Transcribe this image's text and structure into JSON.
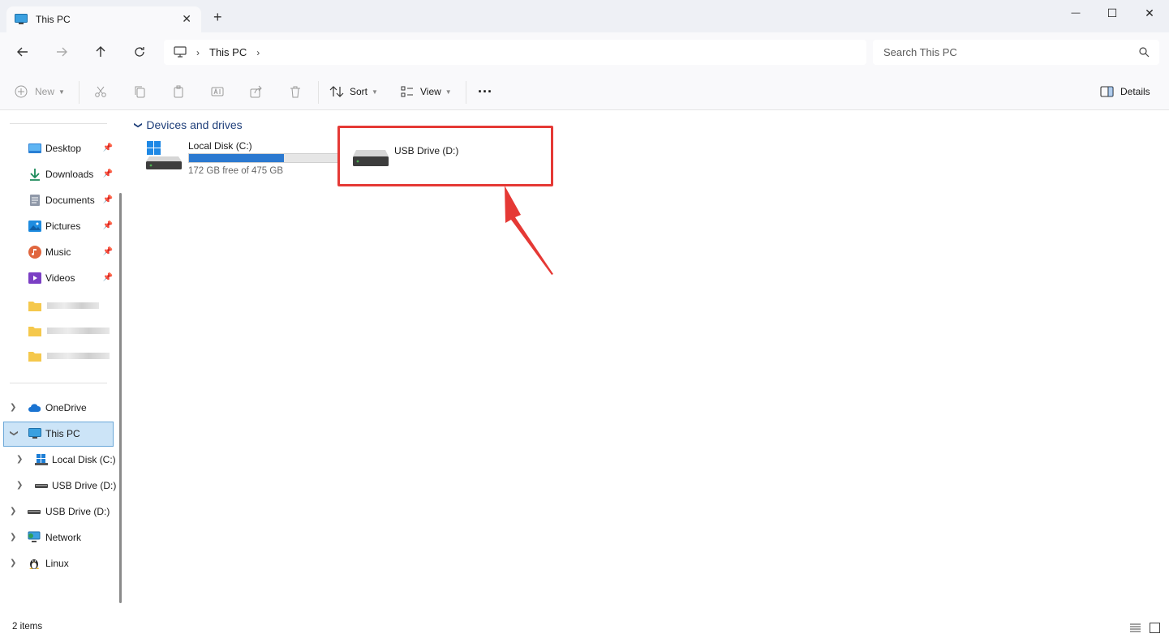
{
  "window": {
    "tab_title": "This PC",
    "tab_close": "✕",
    "new_tab": "+",
    "minimize": "—",
    "maximize": "☐",
    "close": "✕"
  },
  "navigation": {
    "breadcrumb": [
      "This PC"
    ],
    "search_placeholder": "Search This PC"
  },
  "commands": {
    "new": "New",
    "sort": "Sort",
    "view": "View",
    "more": "···",
    "details": "Details"
  },
  "sidebar": {
    "quick_access": [
      {
        "label": "Desktop",
        "icon": "desktop-icon",
        "pinned": true
      },
      {
        "label": "Downloads",
        "icon": "downloads-icon",
        "pinned": true
      },
      {
        "label": "Documents",
        "icon": "documents-icon",
        "pinned": true
      },
      {
        "label": "Pictures",
        "icon": "pictures-icon",
        "pinned": true
      },
      {
        "label": "Music",
        "icon": "music-icon",
        "pinned": true
      },
      {
        "label": "Videos",
        "icon": "videos-icon",
        "pinned": true
      }
    ],
    "tree": [
      {
        "label": "OneDrive",
        "icon": "onedrive-icon",
        "expanded": false
      },
      {
        "label": "This PC",
        "icon": "this-pc-icon",
        "expanded": true,
        "selected": true
      },
      {
        "label": "Local Disk (C:)",
        "icon": "windows-drive-icon",
        "indent": 1
      },
      {
        "label": "USB Drive (D:)",
        "icon": "usb-drive-icon",
        "indent": 1
      },
      {
        "label": "USB Drive (D:)",
        "icon": "usb-drive-icon"
      },
      {
        "label": "Network",
        "icon": "network-icon"
      },
      {
        "label": "Linux",
        "icon": "linux-icon"
      }
    ]
  },
  "content": {
    "group_header": "Devices and drives",
    "drives": [
      {
        "name": "Local Disk (C:)",
        "free_text": "172 GB free of 475 GB",
        "used_fraction": 0.638
      },
      {
        "name": "USB Drive (D:)"
      }
    ]
  },
  "status": {
    "items_count": "2 items"
  },
  "colors": {
    "accent": "#2b79d0",
    "highlight": "#e53935",
    "selection": "#cce4f7"
  }
}
